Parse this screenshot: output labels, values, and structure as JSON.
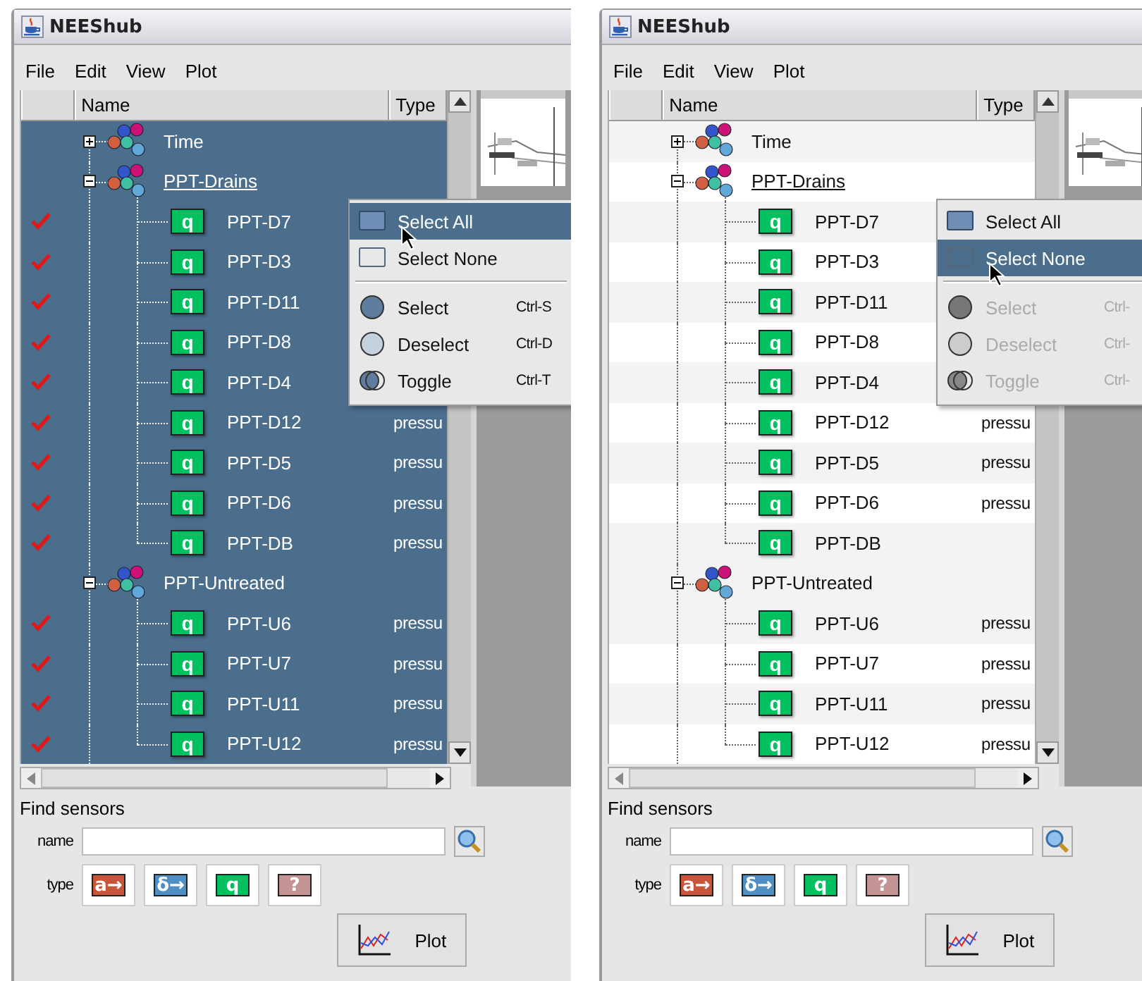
{
  "windows": [
    {
      "title": "NEEShub",
      "menu": [
        "File",
        "Edit",
        "View",
        "Plot"
      ],
      "columns": [
        "Name",
        "Type"
      ],
      "tree": [
        {
          "label": "Time",
          "expanded": false,
          "selected": true,
          "focused": false
        },
        {
          "label": "PPT-Drains",
          "expanded": true,
          "selected": true,
          "focused": true,
          "children": [
            {
              "badge": "q",
              "label": "PPT-D7",
              "checked": true,
              "selected": true
            },
            {
              "badge": "q",
              "label": "PPT-D3",
              "checked": true,
              "selected": true
            },
            {
              "badge": "q",
              "label": "PPT-D11",
              "checked": true,
              "selected": true
            },
            {
              "badge": "q",
              "label": "PPT-D8",
              "checked": true,
              "selected": true
            },
            {
              "badge": "q",
              "label": "PPT-D4",
              "checked": true,
              "selected": true
            },
            {
              "badge": "q",
              "label": "PPT-D12",
              "type": "pressu",
              "checked": true,
              "selected": true
            },
            {
              "badge": "q",
              "label": "PPT-D5",
              "type": "pressu",
              "checked": true,
              "selected": true
            },
            {
              "badge": "q",
              "label": "PPT-D6",
              "type": "pressu",
              "checked": true,
              "selected": true
            },
            {
              "badge": "q",
              "label": "PPT-DB",
              "type": "pressu",
              "checked": true,
              "selected": true
            }
          ]
        },
        {
          "label": "PPT-Untreated",
          "expanded": true,
          "selected": true,
          "focused": false,
          "children": [
            {
              "badge": "q",
              "label": "PPT-U6",
              "type": "pressu",
              "checked": true,
              "selected": true
            },
            {
              "badge": "q",
              "label": "PPT-U7",
              "type": "pressu",
              "checked": true,
              "selected": true
            },
            {
              "badge": "q",
              "label": "PPT-U11",
              "type": "pressu",
              "checked": true,
              "selected": true
            },
            {
              "badge": "q",
              "label": "PPT-U12",
              "type": "pressu",
              "checked": true,
              "selected": true
            }
          ]
        }
      ],
      "popup": [
        {
          "kind": "all",
          "label": "Select All",
          "selected": true,
          "disabled": false
        },
        {
          "kind": "none",
          "label": "Select None",
          "selected": false,
          "disabled": false
        },
        {
          "kind": "separator"
        },
        {
          "kind": "select",
          "label": "Select",
          "shortcut": "Ctrl-S",
          "selected": false,
          "disabled": false
        },
        {
          "kind": "deselect",
          "label": "Deselect",
          "shortcut": "Ctrl-D",
          "selected": false,
          "disabled": false
        },
        {
          "kind": "toggle",
          "label": "Toggle",
          "shortcut": "Ctrl-T",
          "selected": false,
          "disabled": false
        }
      ],
      "find": {
        "heading": "Find sensors",
        "name_label": "name",
        "type_label": "type",
        "types": [
          {
            "kind": "accel",
            "label": "a→"
          },
          {
            "kind": "disp",
            "label": "δ→"
          },
          {
            "kind": "pressure",
            "label": "q"
          },
          {
            "kind": "unknown",
            "label": "?"
          }
        ]
      },
      "plot_button": "Plot"
    },
    {
      "title": "NEEShub",
      "menu": [
        "File",
        "Edit",
        "View",
        "Plot"
      ],
      "columns": [
        "Name",
        "Type"
      ],
      "tree": [
        {
          "label": "Time",
          "expanded": false,
          "selected": false,
          "focused": false
        },
        {
          "label": "PPT-Drains",
          "expanded": true,
          "selected": false,
          "focused": true,
          "children": [
            {
              "badge": "q",
              "label": "PPT-D7",
              "checked": false,
              "selected": false
            },
            {
              "badge": "q",
              "label": "PPT-D3",
              "checked": false,
              "selected": false
            },
            {
              "badge": "q",
              "label": "PPT-D11",
              "checked": false,
              "selected": false
            },
            {
              "badge": "q",
              "label": "PPT-D8",
              "checked": false,
              "selected": false
            },
            {
              "badge": "q",
              "label": "PPT-D4",
              "checked": false,
              "selected": false
            },
            {
              "badge": "q",
              "label": "PPT-D12",
              "type": "pressu",
              "checked": false,
              "selected": false
            },
            {
              "badge": "q",
              "label": "PPT-D5",
              "type": "pressu",
              "checked": false,
              "selected": false
            },
            {
              "badge": "q",
              "label": "PPT-D6",
              "type": "pressu",
              "checked": false,
              "selected": false
            },
            {
              "badge": "q",
              "label": "PPT-DB",
              "checked": false,
              "selected": false
            }
          ]
        },
        {
          "label": "PPT-Untreated",
          "expanded": true,
          "selected": false,
          "focused": false,
          "children": [
            {
              "badge": "q",
              "label": "PPT-U6",
              "type": "pressu",
              "checked": false,
              "selected": false
            },
            {
              "badge": "q",
              "label": "PPT-U7",
              "type": "pressu",
              "checked": false,
              "selected": false
            },
            {
              "badge": "q",
              "label": "PPT-U11",
              "type": "pressu",
              "checked": false,
              "selected": false
            },
            {
              "badge": "q",
              "label": "PPT-U12",
              "type": "pressu",
              "checked": false,
              "selected": false
            }
          ]
        }
      ],
      "popup": [
        {
          "kind": "all",
          "label": "Select All",
          "selected": false,
          "disabled": false
        },
        {
          "kind": "none",
          "label": "Select None",
          "selected": true,
          "disabled": false
        },
        {
          "kind": "separator"
        },
        {
          "kind": "select",
          "label": "Select",
          "shortcut": "Ctrl-",
          "selected": false,
          "disabled": true
        },
        {
          "kind": "deselect",
          "label": "Deselect",
          "shortcut": "Ctrl-",
          "selected": false,
          "disabled": true
        },
        {
          "kind": "toggle",
          "label": "Toggle",
          "shortcut": "Ctrl-",
          "selected": false,
          "disabled": true
        }
      ],
      "find": {
        "heading": "Find sensors",
        "name_label": "name",
        "type_label": "type",
        "types": [
          {
            "kind": "accel",
            "label": "a→"
          },
          {
            "kind": "disp",
            "label": "δ→"
          },
          {
            "kind": "pressure",
            "label": "q"
          },
          {
            "kind": "unknown",
            "label": "?"
          }
        ]
      },
      "plot_button": "Plot"
    }
  ]
}
